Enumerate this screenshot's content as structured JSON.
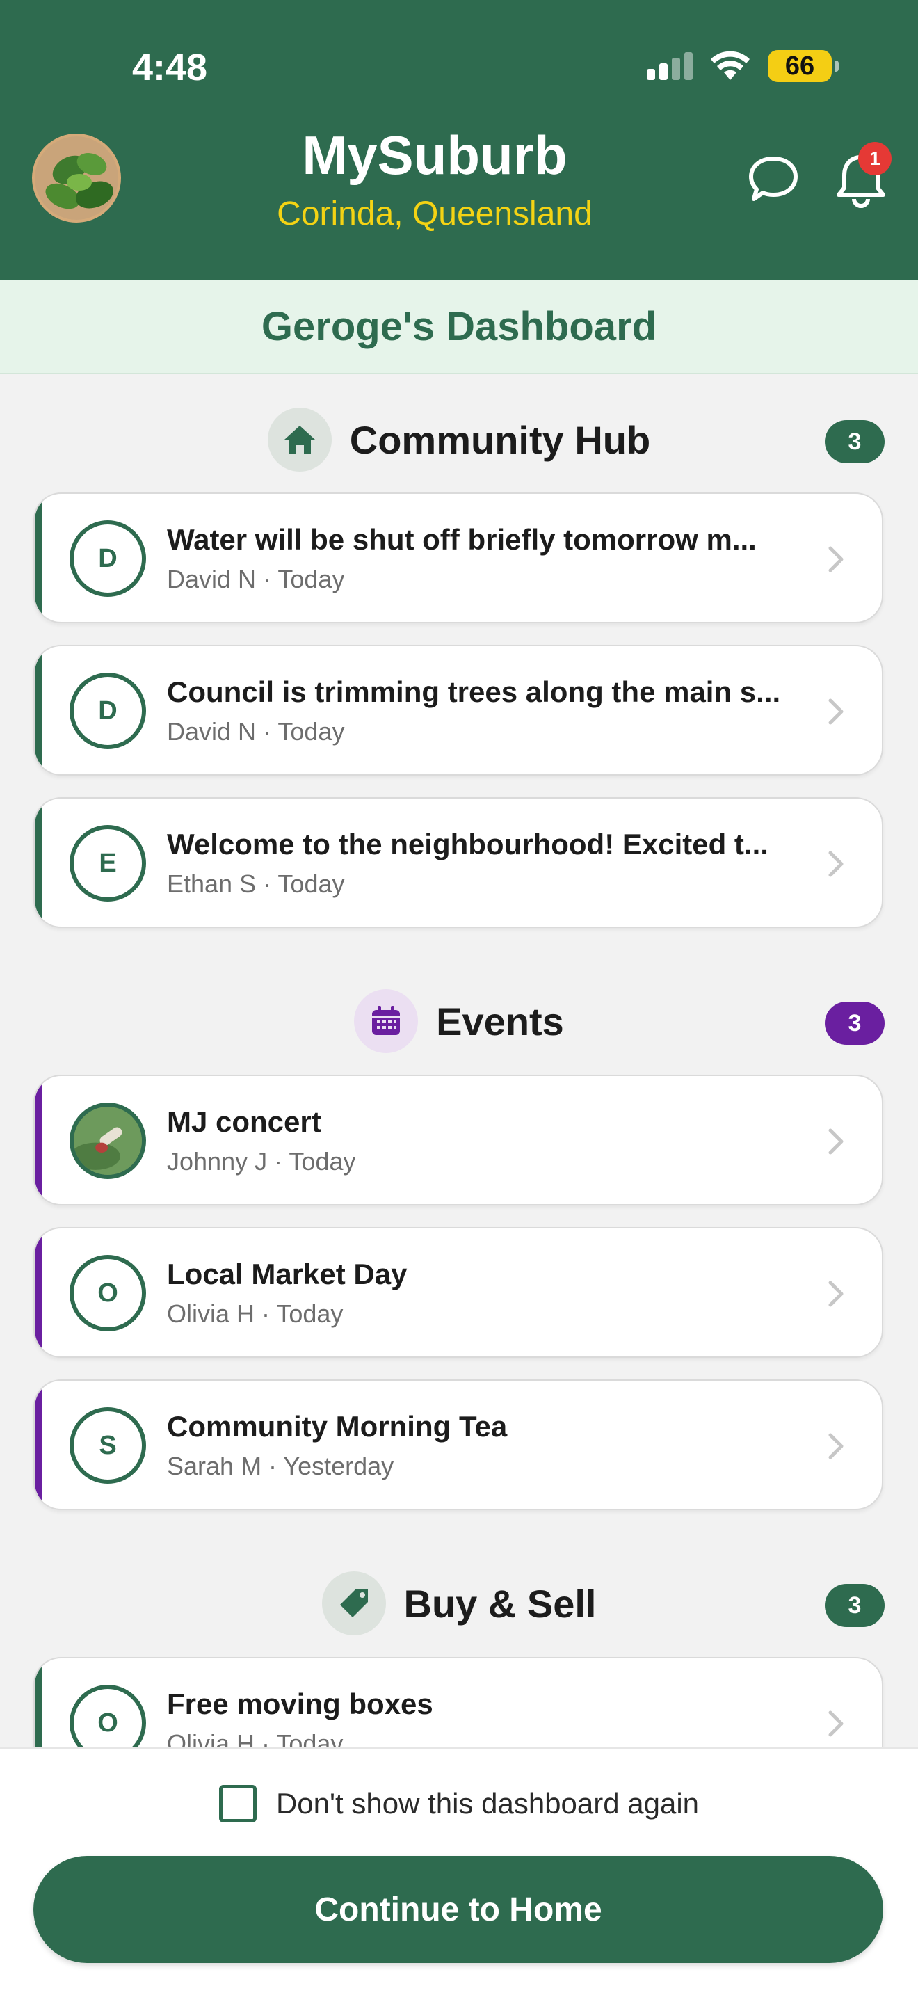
{
  "status": {
    "time": "4:48",
    "battery": "66"
  },
  "header": {
    "title": "MySuburb",
    "subtitle": "Corinda, Queensland",
    "notifications": "1"
  },
  "banner": {
    "title": "Geroge's Dashboard"
  },
  "sections": [
    {
      "title": "Community Hub",
      "count": "3",
      "icon": "home-icon",
      "color": "#2e6b4f",
      "items": [
        {
          "initial": "D",
          "title": "Water will be shut off briefly tomorrow m...",
          "meta": "David N · Today"
        },
        {
          "initial": "D",
          "title": "Council is trimming trees along the main s...",
          "meta": "David N · Today"
        },
        {
          "initial": "E",
          "title": "Welcome to the neighbourhood! Excited t...",
          "meta": "Ethan S · Today"
        }
      ]
    },
    {
      "title": "Events",
      "count": "3",
      "icon": "calendar-icon",
      "color": "#6a1fa0",
      "items": [
        {
          "initial": "",
          "title": "MJ concert",
          "meta": "Johnny J · Today"
        },
        {
          "initial": "O",
          "title": "Local Market Day",
          "meta": "Olivia H · Today"
        },
        {
          "initial": "S",
          "title": "Community Morning Tea",
          "meta": "Sarah M · Yesterday"
        }
      ]
    },
    {
      "title": "Buy & Sell",
      "count": "3",
      "icon": "tag-icon",
      "color": "#2e6b4f",
      "items": [
        {
          "initial": "O",
          "title": "Free moving boxes",
          "meta": "Olivia H · Today"
        }
      ]
    }
  ],
  "footer": {
    "checkbox_label": "Don't show this dashboard again",
    "button": "Continue to Home"
  }
}
